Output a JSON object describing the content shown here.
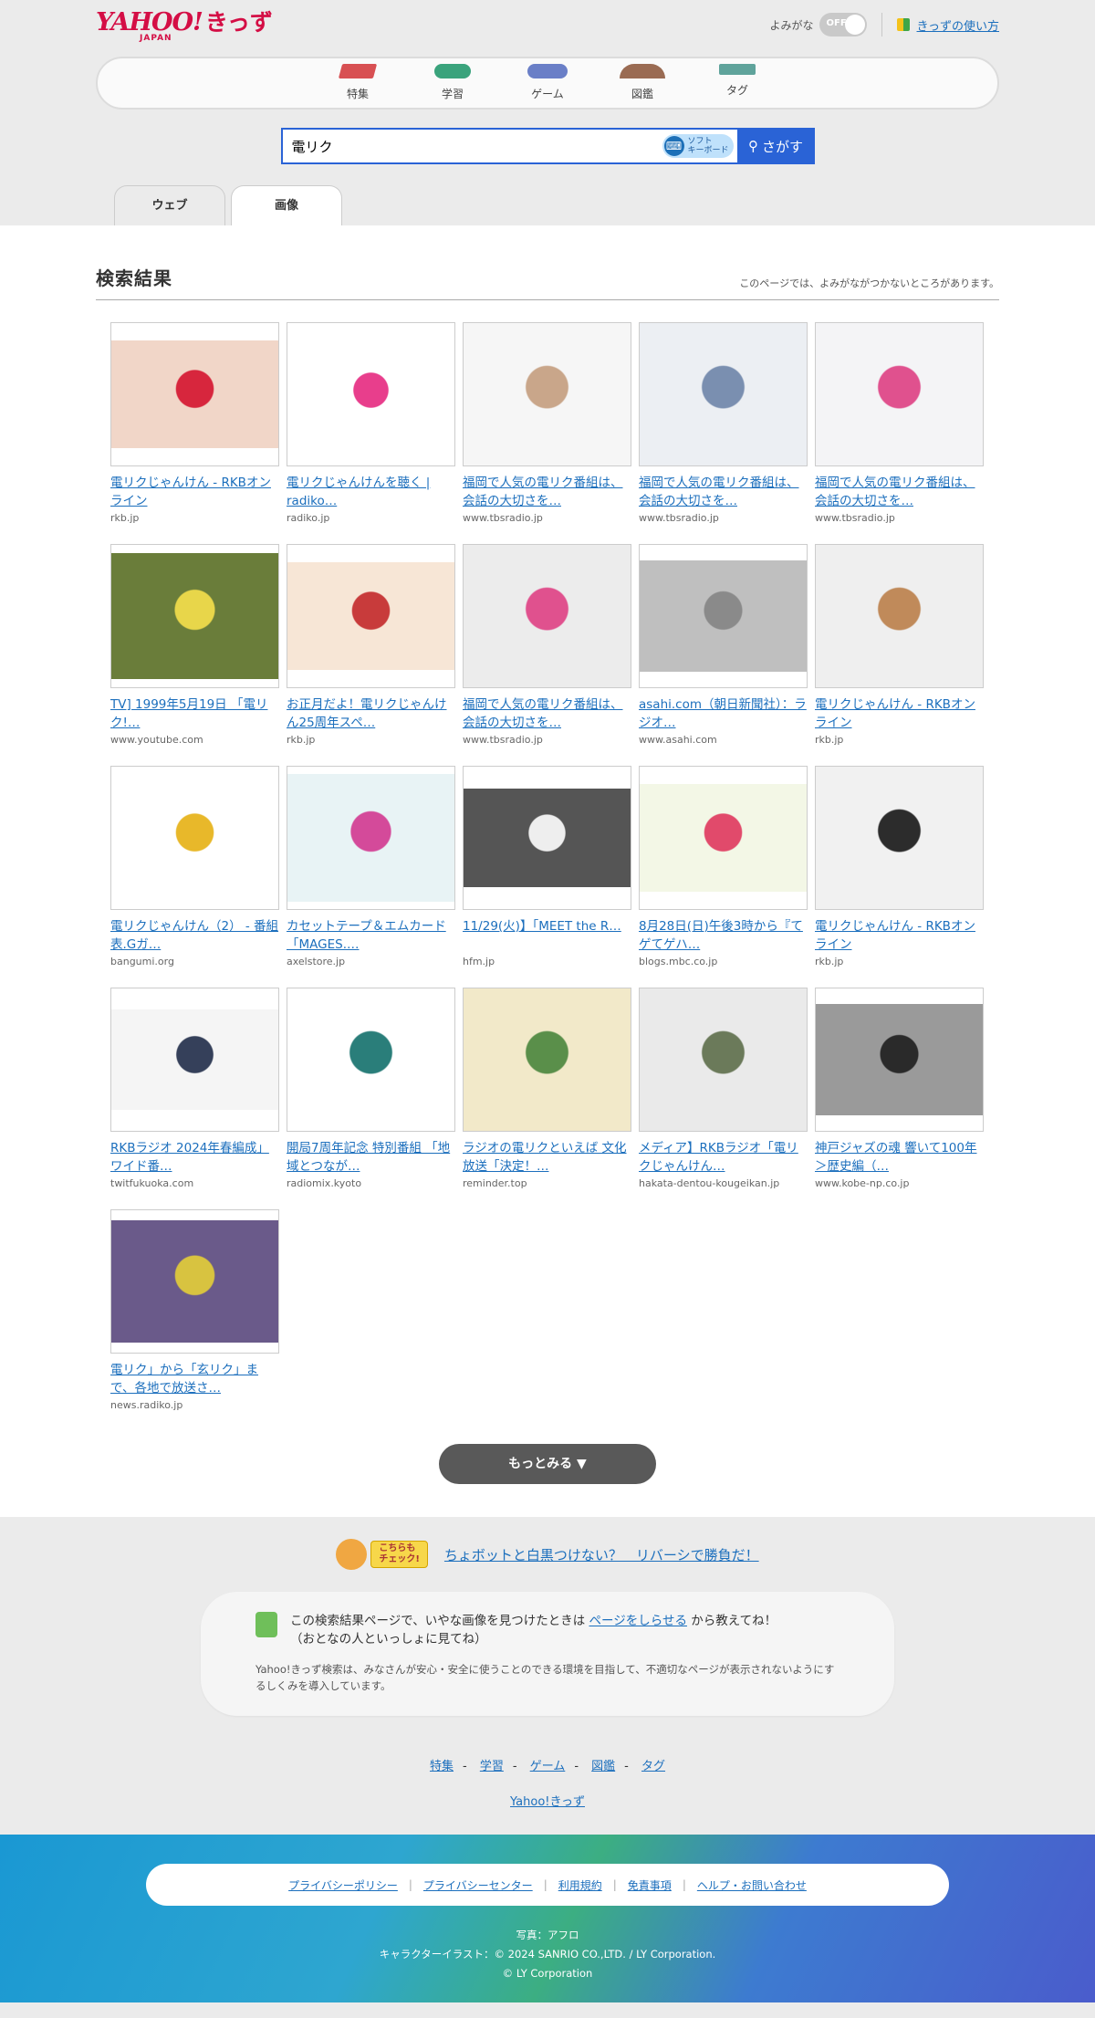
{
  "header": {
    "logo_text": "YAHOO!",
    "logo_kids": "きっず",
    "logo_japan": "JAPAN",
    "yomigana_label": "よみがな",
    "toggle_state": "OFF",
    "help_link": "きっずの使い方"
  },
  "nav": [
    {
      "label": "特集",
      "icon": "tokushu-icon"
    },
    {
      "label": "学習",
      "icon": "gakushu-icon"
    },
    {
      "label": "ゲーム",
      "icon": "game-icon"
    },
    {
      "label": "図鑑",
      "icon": "zukan-icon"
    },
    {
      "label": "タグ",
      "icon": "tag-icon"
    }
  ],
  "search": {
    "value": "電リク",
    "keyboard_label_1": "ソフト",
    "keyboard_label_2": "キーボード",
    "button": "さがす"
  },
  "tabs": [
    {
      "label": "ウェブ",
      "active": false
    },
    {
      "label": "画像",
      "active": true
    }
  ],
  "results": {
    "title": "検索結果",
    "note": "このページでは、よみがながつかないところがあります。",
    "items": [
      {
        "title": "電リクじゃんけん - RKBオンライン",
        "domain": "rkb.jp"
      },
      {
        "title": "電リクじゃんけんを聴く | radiko…",
        "domain": "radiko.jp"
      },
      {
        "title": "福岡で人気の電リク番組は、会話の大切さを…",
        "domain": "www.tbsradio.jp"
      },
      {
        "title": "福岡で人気の電リク番組は、会話の大切さを…",
        "domain": "www.tbsradio.jp"
      },
      {
        "title": "福岡で人気の電リク番組は、会話の大切さを…",
        "domain": "www.tbsradio.jp"
      },
      {
        "title": "TV] 1999年5月19日 「電リク!…",
        "domain": "www.youtube.com"
      },
      {
        "title": "お正月だよ！電リクじゃんけん25周年スペ…",
        "domain": "rkb.jp"
      },
      {
        "title": "福岡で人気の電リク番組は、会話の大切さを…",
        "domain": "www.tbsradio.jp"
      },
      {
        "title": "asahi.com（朝日新聞社）：ラジオ…",
        "domain": "www.asahi.com"
      },
      {
        "title": "電リクじゃんけん - RKBオンライン",
        "domain": "rkb.jp"
      },
      {
        "title": "電リクじゃんけん（2） - 番組表.Gガ…",
        "domain": "bangumi.org"
      },
      {
        "title": "カセットテープ＆エムカード「MAGES.…",
        "domain": "axelstore.jp"
      },
      {
        "title": "11/29(火)】「MEET the R…",
        "domain": "hfm.jp"
      },
      {
        "title": "8月28日(日)午後3時から『てゲてゲハ…",
        "domain": "blogs.mbc.co.jp"
      },
      {
        "title": "電リクじゃんけん - RKBオンライン",
        "domain": "rkb.jp"
      },
      {
        "title": "RKBラジオ 2024年春編成」ワイド番…",
        "domain": "twitfukuoka.com"
      },
      {
        "title": "開局7周年記念 特別番組 「地域とつなが…",
        "domain": "radiomix.kyoto"
      },
      {
        "title": "ラジオの電リクといえば 文化放送「決定！…",
        "domain": "reminder.top"
      },
      {
        "title": "メディア】RKBラジオ「電リクじゃんけん…",
        "domain": "hakata-dentou-kougeikan.jp"
      },
      {
        "title": "神戸ジャズの魂 響いて100年 ＞歴史編（…",
        "domain": "www.kobe-np.co.jp"
      },
      {
        "title": "電リク」から「玄リク」まで、各地で放送さ…",
        "domain": "news.radiko.jp"
      }
    ],
    "more_button": "もっとみる ▼"
  },
  "footer": {
    "chobot_badge_1": "こちらも",
    "chobot_badge_2": "チェック!",
    "chobot_link": "ちょボットと白黒つけない？　リバーシで勝負だ！",
    "report_pre": "この検索結果ページで、いやな画像を見つけたときは",
    "report_link": "ページをしらせる",
    "report_post": "から教えてね！",
    "report_line2": "（おとなの人といっしょに見てね）",
    "report_small": "Yahoo!きっず検索は、みなさんが安心・安全に使うことのできる環境を目指して、不適切なページが表示されないようにするしくみを導入しています。",
    "links": [
      "特集",
      "学習",
      "ゲーム",
      "図鑑",
      "タグ"
    ],
    "kizzu_link": "Yahoo!きっず",
    "policy_links": [
      "プライバシーポリシー",
      "プライバシーセンター",
      "利用規約",
      "免責事項",
      "ヘルプ・お問い合わせ"
    ],
    "credit_1": "写真：アフロ",
    "credit_2": "キャラクターイラスト：© 2024 SANRIO CO.,LTD. / LY Corporation.",
    "credit_3": "© LY Corporation"
  }
}
